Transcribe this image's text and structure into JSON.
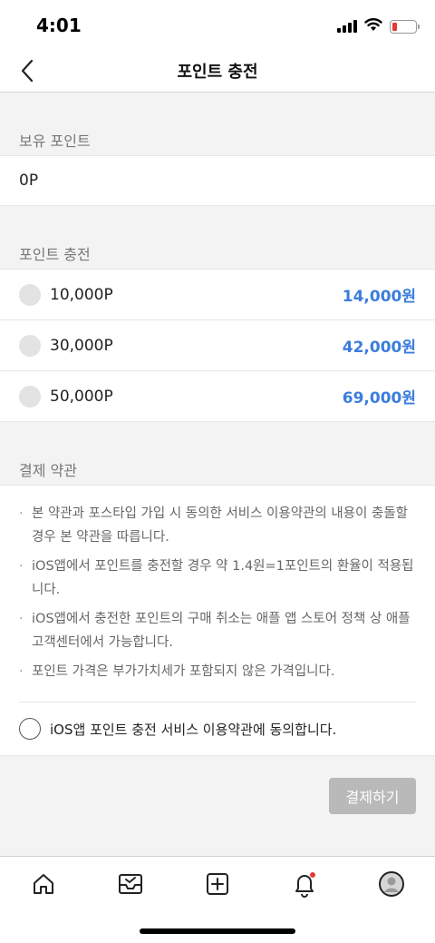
{
  "status_bar": {
    "time": "4:01"
  },
  "header": {
    "title": "포인트 충전"
  },
  "balance": {
    "label": "보유 포인트",
    "value": "0P"
  },
  "charge": {
    "label": "포인트 충전",
    "options": [
      {
        "points": "10,000P",
        "price": "14,000원"
      },
      {
        "points": "30,000P",
        "price": "42,000원"
      },
      {
        "points": "50,000P",
        "price": "69,000원"
      }
    ]
  },
  "terms": {
    "label": "결제 약관",
    "items": [
      "본 약관과 포스타입 가입 시 동의한 서비스 이용약관의 내용이 충돌할 경우 본 약관을 따릅니다.",
      "iOS앱에서 포인트를 충전할 경우 약 1.4원=1포인트의 환율이 적용됩니다.",
      "iOS앱에서 충전한 포인트의 구매 취소는 애플 앱 스토어 정책 상 애플 고객센터에서 가능합니다.",
      "포인트 가격은 부가가치세가 포함되지 않은 가격입니다."
    ],
    "agree_label": "iOS앱 포인트 충전 서비스 이용약관에 동의합니다."
  },
  "pay_button": {
    "label": "결제하기"
  },
  "colors": {
    "accent": "#3b7ddd",
    "disabled_button": "#b9b9b9",
    "badge": "#e53935"
  },
  "tab_bar": {
    "icons": [
      "home-icon",
      "inbox-icon",
      "add-post-icon",
      "bell-icon",
      "profile-avatar-icon"
    ]
  }
}
